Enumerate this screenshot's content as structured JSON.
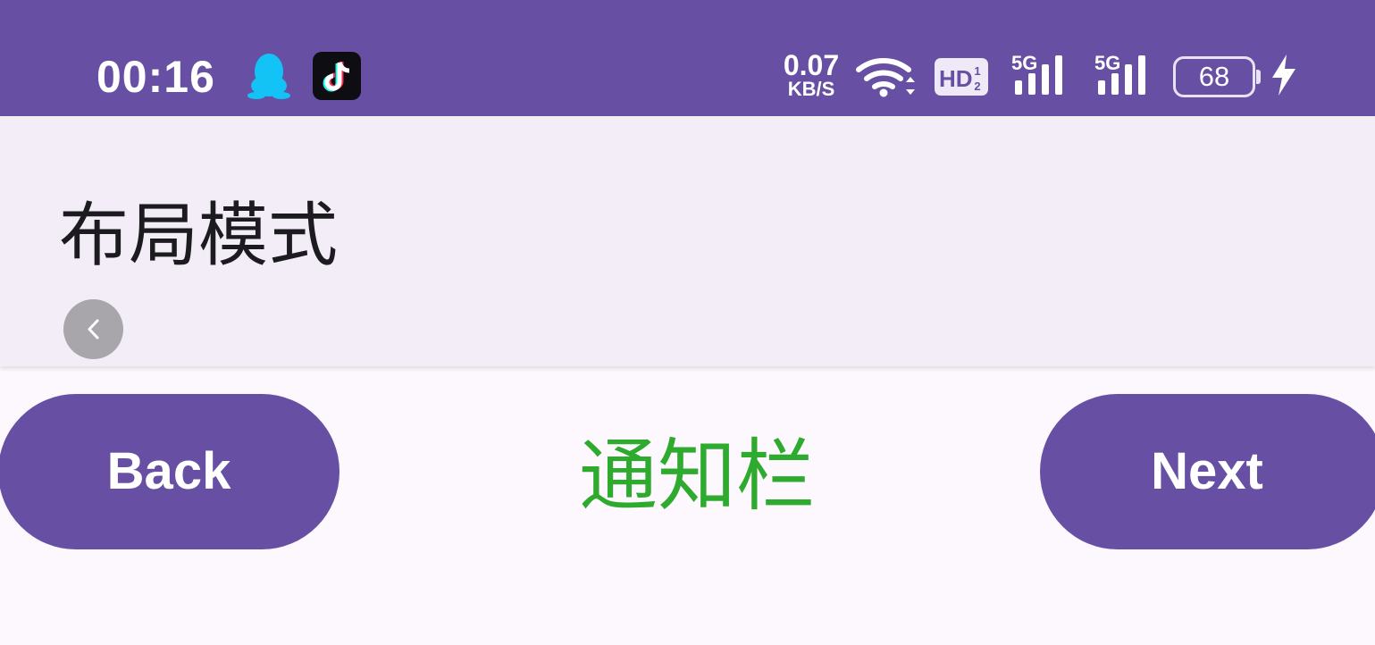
{
  "status_bar": {
    "time": "00:16",
    "notification_icons": [
      "qq-icon",
      "tiktok-icon"
    ],
    "net_speed_value": "0.07",
    "net_speed_unit": "KB/S",
    "wifi_icon": "wifi-icon",
    "hd_badge": "HD",
    "hd_badge_sub": "1/2",
    "signal_1_label": "5G",
    "signal_2_label": "5G",
    "battery_level": "68",
    "charging": true
  },
  "app_bar": {
    "title": "布局模式",
    "back_icon": "chevron-left-icon"
  },
  "main": {
    "back_button_label": "Back",
    "center_label": "通知栏",
    "next_button_label": "Next"
  },
  "colors": {
    "primary": "#6750a4",
    "app_bar_bg": "#f2edf7",
    "page_bg": "#fdf8fd",
    "center_label": "#2eab2e"
  }
}
